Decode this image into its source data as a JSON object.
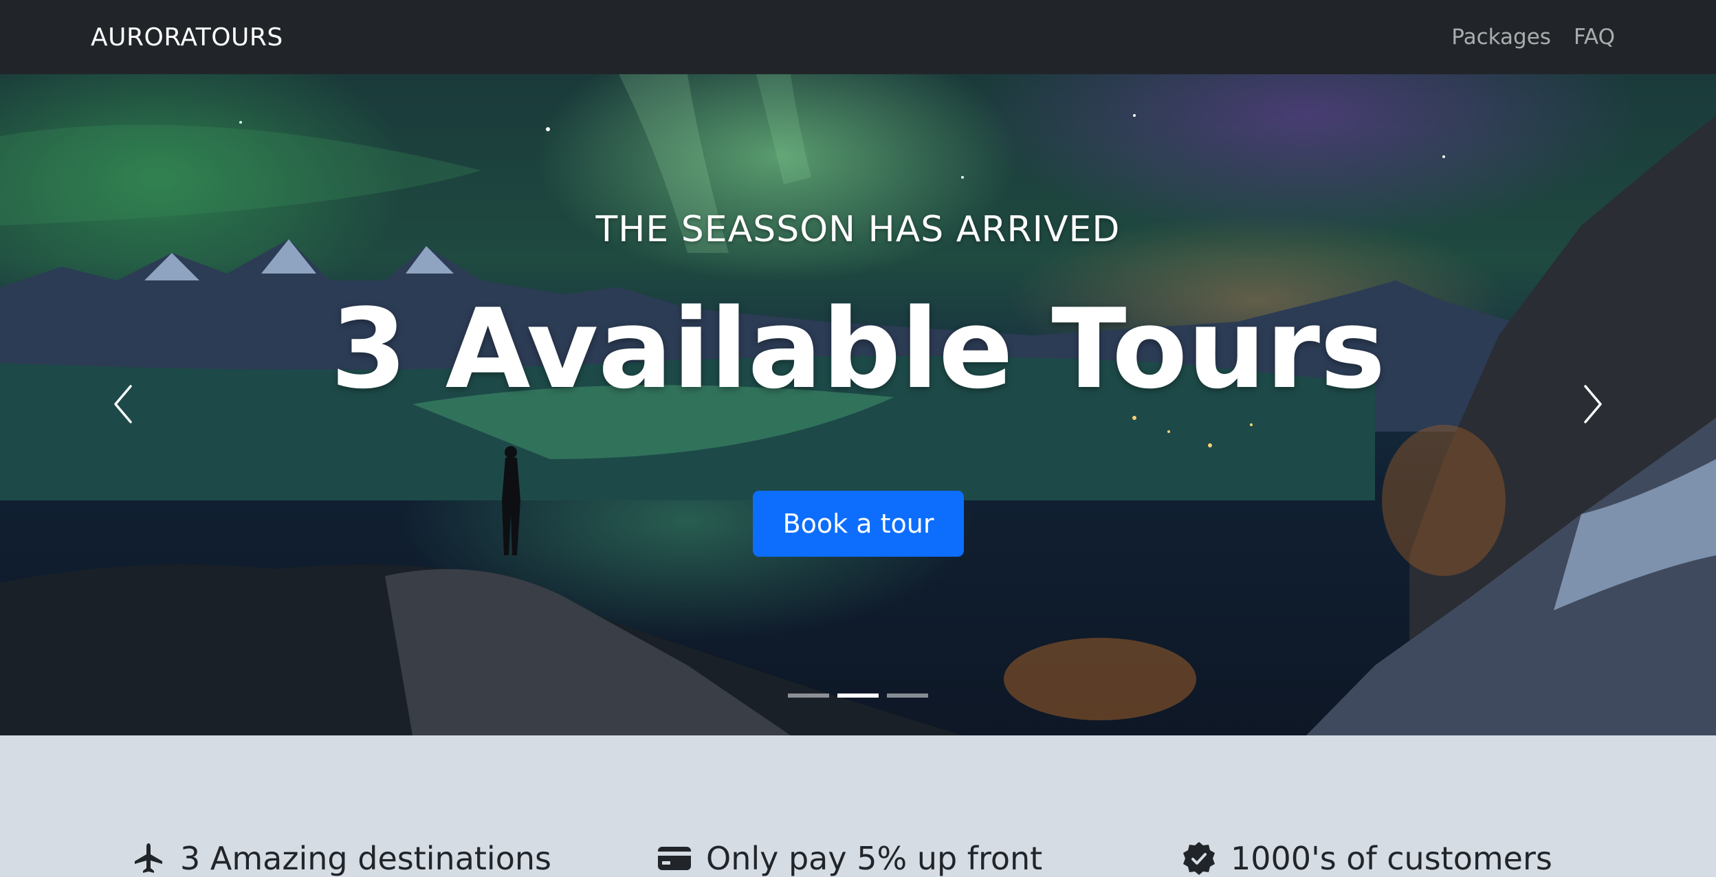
{
  "navbar": {
    "brand": "AURORATOURS",
    "links": [
      {
        "label": "Packages"
      },
      {
        "label": "FAQ"
      }
    ]
  },
  "hero": {
    "subtitle": "THE SEASSON HAS ARRIVED",
    "title": "3 Available Tours",
    "cta_label": "Book a tour",
    "prev_icon": "chevron-left-icon",
    "next_icon": "chevron-right-icon",
    "slides_count": 3,
    "active_slide": 2
  },
  "features": [
    {
      "icon": "airplane-icon",
      "label": "3 Amazing destinations"
    },
    {
      "icon": "credit-card-icon",
      "label": "Only pay 5% up front"
    },
    {
      "icon": "verified-badge-icon",
      "label": "1000's of customers"
    }
  ],
  "colors": {
    "navbar_bg": "#212529",
    "primary": "#0d6efd",
    "features_bg": "#d5dce4",
    "text_dark": "#212529"
  }
}
